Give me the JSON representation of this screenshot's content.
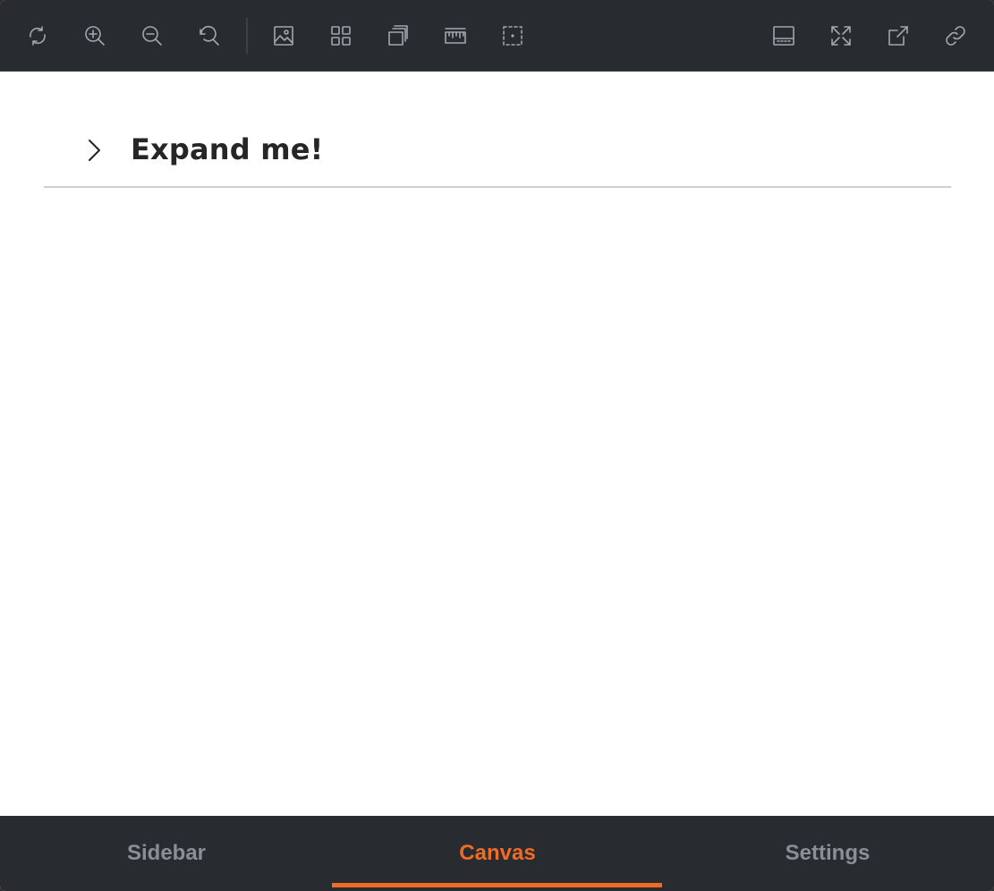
{
  "toolbar": {
    "left_buttons": [
      {
        "icon": "refresh-icon"
      },
      {
        "icon": "zoom-in-icon"
      },
      {
        "icon": "zoom-out-icon"
      },
      {
        "icon": "reset-zoom-icon"
      },
      {
        "icon": "image-icon"
      },
      {
        "icon": "grid-icon"
      },
      {
        "icon": "layers-icon"
      },
      {
        "icon": "ruler-icon"
      },
      {
        "icon": "selection-icon"
      }
    ],
    "right_buttons": [
      {
        "icon": "panel-bottom-icon"
      },
      {
        "icon": "fullscreen-icon"
      },
      {
        "icon": "open-external-icon"
      },
      {
        "icon": "link-icon"
      }
    ],
    "icon_color": "#a3a7ad",
    "background": "#282b30"
  },
  "collapsible": {
    "title": "Expand me!",
    "expanded": false
  },
  "tabs": {
    "items": [
      {
        "label": "Sidebar",
        "active": false
      },
      {
        "label": "Canvas",
        "active": true
      },
      {
        "label": "Settings",
        "active": false
      }
    ],
    "accent": "#f06b24"
  }
}
